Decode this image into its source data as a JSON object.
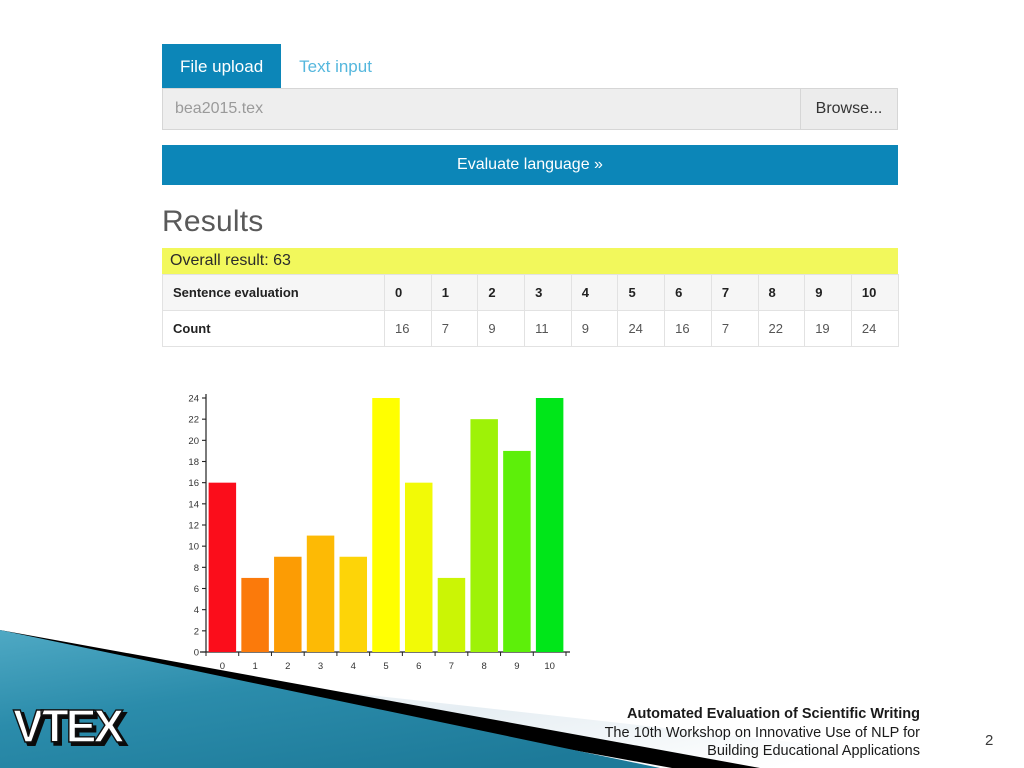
{
  "app": {
    "tabs": [
      {
        "label": "File upload",
        "active": true
      },
      {
        "label": "Text input",
        "active": false
      }
    ],
    "file_input": {
      "value": "bea2015.tex",
      "placeholder": "bea2015.tex",
      "browse_label": "Browse..."
    },
    "evaluate_button_label": "Evaluate language »",
    "results_heading": "Results",
    "overall_result_label": "Overall result: 63",
    "overall_result_value": 63,
    "overall_result_bg": "#f2f85c",
    "table": {
      "header_label": "Sentence evaluation",
      "row_label": "Count",
      "columns": [
        "0",
        "1",
        "2",
        "3",
        "4",
        "5",
        "6",
        "7",
        "8",
        "9",
        "10"
      ],
      "counts": [
        "16",
        "7",
        "9",
        "11",
        "9",
        "24",
        "16",
        "7",
        "22",
        "19",
        "24"
      ]
    }
  },
  "chart_data": {
    "type": "bar",
    "title": "",
    "xlabel": "",
    "ylabel": "",
    "categories": [
      "0",
      "1",
      "2",
      "3",
      "4",
      "5",
      "6",
      "7",
      "8",
      "9",
      "10"
    ],
    "values": [
      16,
      7,
      9,
      11,
      9,
      24,
      16,
      7,
      22,
      19,
      24
    ],
    "ylim": [
      0,
      24
    ],
    "yticks": [
      0,
      2,
      4,
      6,
      8,
      10,
      12,
      14,
      16,
      18,
      20,
      22,
      24
    ],
    "grid": false,
    "legend": "none",
    "bar_colors": [
      "#FB0D1B",
      "#FB7A0B",
      "#FC9C04",
      "#FDBA05",
      "#FDD408",
      "#FFFF00",
      "#F2FA06",
      "#CBF505",
      "#9EF207",
      "#5DEF0A",
      "#00E619"
    ]
  },
  "footer": {
    "line1": "Automated Evaluation of Scientific Writing",
    "line2": "The 10th Workshop on Innovative Use of NLP for",
    "line3": "Building Educational Applications",
    "page_number": "2",
    "logo_text": "VTEX"
  },
  "theme": {
    "accent_blue": "#0c86b8",
    "tab_inactive": "#55b7dd",
    "deco_teal": "#2e90ae",
    "deco_black": "#000000",
    "deco_light": "#dfe8ee"
  }
}
